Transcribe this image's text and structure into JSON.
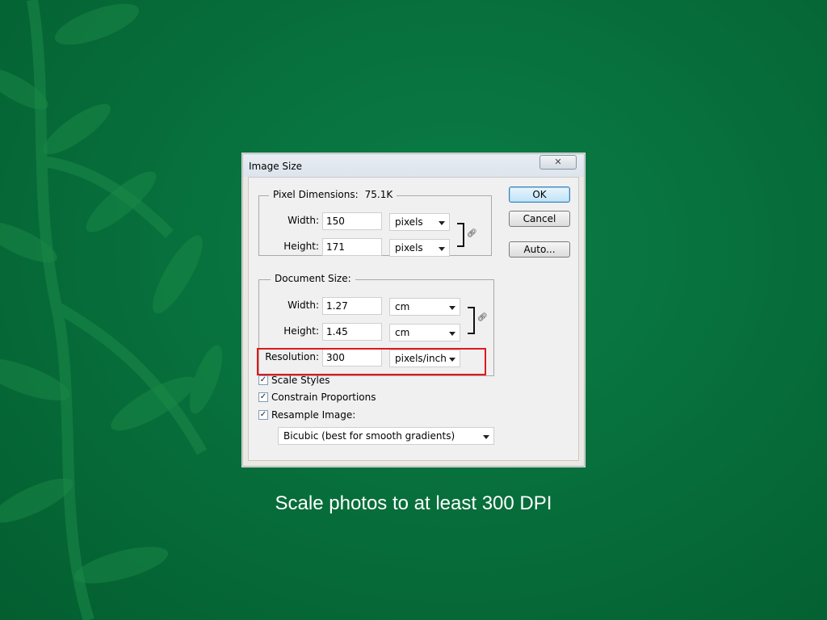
{
  "dialog": {
    "title": "Image Size",
    "close_icon": "close-icon",
    "pixel_dimensions": {
      "legend": "Pixel Dimensions:",
      "size": "75.1K",
      "width_label": "Width:",
      "width_value": "150",
      "width_unit": "pixels",
      "height_label": "Height:",
      "height_value": "171",
      "height_unit": "pixels"
    },
    "document_size": {
      "legend": "Document Size:",
      "width_label": "Width:",
      "width_value": "1.27",
      "width_unit": "cm",
      "height_label": "Height:",
      "height_value": "1.45",
      "height_unit": "cm",
      "resolution_label": "Resolution:",
      "resolution_value": "300",
      "resolution_unit": "pixels/inch"
    },
    "buttons": {
      "ok": "OK",
      "cancel": "Cancel",
      "auto": "Auto..."
    },
    "options": {
      "scale_styles": {
        "label": "Scale Styles",
        "checked": true
      },
      "constrain_proportions": {
        "label": "Constrain Proportions",
        "checked": true
      },
      "resample_image": {
        "label": "Resample Image:",
        "checked": true
      }
    },
    "resample_method": "Bicubic (best for smooth gradients)",
    "highlight_color": "#e0181b"
  },
  "caption": "Scale photos to at least 300 DPI",
  "colors": {
    "background": "#07703c",
    "caption": "#ffffff"
  }
}
